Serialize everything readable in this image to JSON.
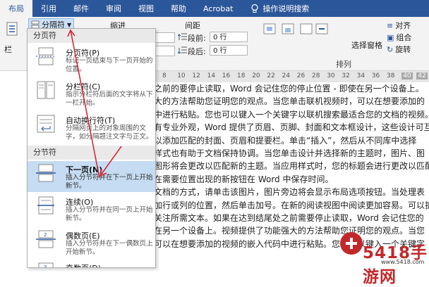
{
  "tabs": [
    "布局",
    "引用",
    "邮件",
    "审阅",
    "视图",
    "帮助",
    "Acrobat"
  ],
  "tell_me": "操作说明搜索",
  "ribbon": {
    "breaks_button": "分隔符",
    "column_label": "栏",
    "indent_label": "缩进",
    "spacing_label": "间距",
    "before_label": "段前:",
    "before_value": "0 行",
    "after_label": "段后:",
    "after_value": "0 行",
    "align_label": "对齐",
    "combine_label": "组合",
    "rotate_label": "旋转",
    "selection_pane": "选择窗格",
    "arrange_group": "排列"
  },
  "ruler": {
    "numbers": [
      "8",
      "10",
      "12",
      "14",
      "16",
      "18",
      "20",
      "22",
      "24",
      "26",
      "28",
      "30",
      "32",
      "34",
      "36",
      "38",
      "40",
      "42"
    ]
  },
  "document_lines": [
    "之前的要停止读取，Word 会记住您的停止位置 - 即使在另一个设备上。",
    "大的方法帮助您证明您的观点。当您单击联机视频时，可以在想要添加的",
    "中进行粘贴。您也可以键入一个关键字以联机搜索最适合您的文档的视频。",
    "有专业外观，Word 提供了页眉、页脚、封面和文本框设计，这些设计可互",
    "以添加匹配的封面、页眉和提要栏。单击“插入”，然后从不同库中选择",
    "样式也有助于文档保持协调。当您单击设计并选择新的主题时，图片、图",
    "图形将会更改以匹配新的主题。当应用样式时，您的标题会进行更改以匹配",
    "在需要位置出现的新按钮在  Word 中保存时间。",
    "文档的方式，请单击该图片，图片旁边将会显示布局选项按钮。当处理表",
    "加行或列的位置，然后单击加号。在新的阅读视图中阅读更加容易。可以折",
    "关注所需文本。如果在达到结尾处之前需要停止读取，Word 会记住您的",
    "在另一个设备上。视频提供了功能强大的方法帮助您证明您的观点。当您",
    "可以在想要添加的视频的嵌入代码中进行粘贴。您也可以键入一个关键字"
  ],
  "menu": {
    "section_page": "分页符",
    "section_section": "分节符",
    "items": [
      {
        "title": "分页符(P)",
        "desc": [
          "标记一页结束与下一页开始的",
          "位置。"
        ]
      },
      {
        "title": "分栏符(C)",
        "desc": [
          "指示分栏符后面的文字将从下",
          "一栏开始。"
        ]
      },
      {
        "title": "自动换行符(T)",
        "desc": [
          "分隔网页上的对象周围的文",
          "字，如分隔题注文字与正文。"
        ]
      },
      {
        "title": "下一页(N)",
        "desc": [
          "插入分节符并在下一页上开始",
          "新节。"
        ]
      },
      {
        "title": "连续(O)",
        "desc": [
          "插入分节符并在同一页上开始",
          "新节。"
        ]
      },
      {
        "title": "偶数页(E)",
        "desc": [
          "插入分节符并在下一偶数页上",
          "开始新节。"
        ]
      },
      {
        "title": "奇数页(D)",
        "desc": []
      }
    ]
  },
  "watermark": {
    "text": "5418手游网",
    "url": "www.5418.com"
  },
  "colors": {
    "ribbon_blue": "#2b579a",
    "hover": "#c5dcf2",
    "arrow": "#d42b3a",
    "watermark_red": "#c2282b"
  }
}
